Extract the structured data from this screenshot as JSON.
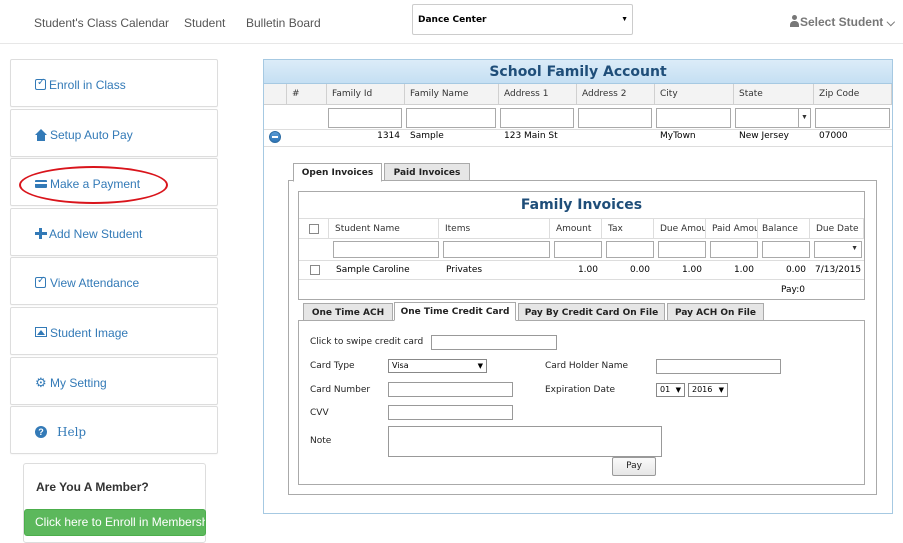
{
  "nav": {
    "links": [
      "Student's Class Calendar",
      "Student",
      "Bulletin Board"
    ],
    "school_select": "Dance Center",
    "select_student": "Select Student"
  },
  "sidebar": {
    "items": [
      {
        "label": "Enroll in Class",
        "icon": "edit-icon"
      },
      {
        "label": "Setup Auto Pay",
        "icon": "home-icon"
      },
      {
        "label": "Make a Payment",
        "icon": "credit-card-icon"
      },
      {
        "label": "Add New Student",
        "icon": "plus-icon"
      },
      {
        "label": "View Attendance",
        "icon": "check-square-icon"
      },
      {
        "label": "Student Image",
        "icon": "picture-icon"
      },
      {
        "label": "My Setting",
        "icon": "gear-icon"
      },
      {
        "label": "Help",
        "icon": "question-icon"
      }
    ],
    "member_title": "Are You A Member?",
    "member_button": "Click here to Enroll in Membership"
  },
  "account": {
    "title": "School Family Account",
    "columns": [
      "#",
      "Family Id",
      "Family Name",
      "Address 1",
      "Address 2",
      "City",
      "State",
      "Zip Code"
    ],
    "row": {
      "family_id": "1314",
      "family_name": "Sample",
      "address1": "123 Main St",
      "address2": "",
      "city": "MyTown",
      "state": "New Jersey",
      "zip": "07000"
    }
  },
  "tabs": {
    "open": "Open Invoices",
    "paid": "Paid Invoices"
  },
  "invoices": {
    "title": "Family Invoices",
    "columns": [
      "Student Name",
      "Items",
      "Amount",
      "Tax",
      "Due Amou",
      "Paid Amou",
      "Balance",
      "Due Date"
    ],
    "row": {
      "student": "Sample Caroline",
      "items": "Privates",
      "amount": "1.00",
      "tax": "0.00",
      "due": "1.00",
      "paid": "1.00",
      "balance": "0.00",
      "due_date": "7/13/2015"
    },
    "footer": "Pay:0"
  },
  "pay_tabs": [
    "One Time ACH",
    "One Time Credit Card",
    "Pay By Credit Card On File",
    "Pay ACH On File"
  ],
  "payment_form": {
    "swipe_label": "Click to swipe credit card",
    "card_type_label": "Card Type",
    "card_type_value": "Visa",
    "holder_label": "Card Holder Name",
    "card_number_label": "Card Number",
    "expiration_label": "Expiration Date",
    "exp_month": "01",
    "exp_year": "2016",
    "cvv_label": "CVV",
    "note_label": "Note",
    "pay_button": "Pay"
  },
  "colors": {
    "link": "#337ab7",
    "title_blue": "#1f4e79",
    "highlight_red": "#d9141b",
    "member_green": "#5cb85c"
  }
}
